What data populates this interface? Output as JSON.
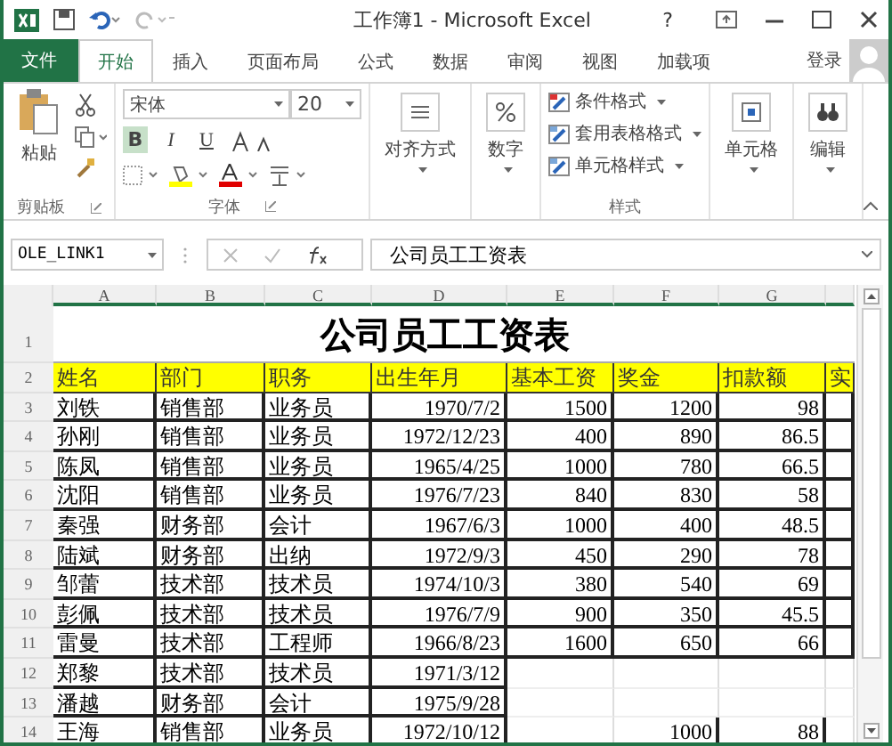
{
  "window": {
    "title": "工作簿1 - Microsoft Excel",
    "help": "?"
  },
  "tabs": [
    {
      "label": "文件",
      "kind": "file",
      "selected": false
    },
    {
      "label": "开始",
      "kind": "tab",
      "selected": true
    },
    {
      "label": "插入",
      "kind": "tab",
      "selected": false
    },
    {
      "label": "页面布局",
      "kind": "tab",
      "selected": false
    },
    {
      "label": "公式",
      "kind": "tab",
      "selected": false
    },
    {
      "label": "数据",
      "kind": "tab",
      "selected": false
    },
    {
      "label": "审阅",
      "kind": "tab",
      "selected": false
    },
    {
      "label": "视图",
      "kind": "tab",
      "selected": false
    },
    {
      "label": "加载项",
      "kind": "tab",
      "selected": false
    }
  ],
  "login": "登录",
  "ribbon": {
    "paste": "粘贴",
    "clipboard_group": "剪贴板",
    "font_name": "宋体",
    "font_size": "20",
    "styles": [
      {
        "label": "B",
        "kind": "bold",
        "selected": true
      },
      {
        "label": "I",
        "kind": "italic",
        "selected": false
      },
      {
        "label": "U",
        "kind": "underline",
        "selected": false
      }
    ],
    "font_group": "字体",
    "alignment": "对齐方式",
    "number": "数字",
    "style_items": [
      "条件格式",
      "套用表格格式",
      "单元格样式"
    ],
    "styles_group": "样式",
    "cells": "单元格",
    "editing": "编辑"
  },
  "formula_bar": {
    "name_box": "OLE_LINK1",
    "formula": "公司员工工资表"
  },
  "sheet": {
    "columns": [
      "A",
      "B",
      "C",
      "D",
      "E",
      "F",
      "G"
    ],
    "title_row": {
      "num": "1",
      "text": "公司员工工资表"
    },
    "header_row": {
      "num": "2",
      "cells": [
        "姓名",
        "部门",
        "职务",
        "出生年月",
        "基本工资",
        "奖金",
        "扣款额",
        "实"
      ]
    },
    "rows": [
      {
        "num": "3",
        "cells": [
          "刘铁",
          "销售部",
          "业务员",
          "1970/7/2",
          "1500",
          "1200",
          "98"
        ]
      },
      {
        "num": "4",
        "cells": [
          "孙刚",
          "销售部",
          "业务员",
          "1972/12/23",
          "400",
          "890",
          "86.5"
        ]
      },
      {
        "num": "5",
        "cells": [
          "陈凤",
          "销售部",
          "业务员",
          "1965/4/25",
          "1000",
          "780",
          "66.5"
        ]
      },
      {
        "num": "6",
        "cells": [
          "沈阳",
          "销售部",
          "业务员",
          "1976/7/23",
          "840",
          "830",
          "58"
        ]
      },
      {
        "num": "7",
        "cells": [
          "秦强",
          "财务部",
          "会计",
          "1967/6/3",
          "1000",
          "400",
          "48.5"
        ]
      },
      {
        "num": "8",
        "cells": [
          "陆斌",
          "财务部",
          "出纳",
          "1972/9/3",
          "450",
          "290",
          "78"
        ]
      },
      {
        "num": "9",
        "cells": [
          "邹蕾",
          "技术部",
          "技术员",
          "1974/10/3",
          "380",
          "540",
          "69"
        ]
      },
      {
        "num": "10",
        "cells": [
          "彭佩",
          "技术部",
          "技术员",
          "1976/7/9",
          "900",
          "350",
          "45.5"
        ]
      },
      {
        "num": "11",
        "cells": [
          "雷曼",
          "技术部",
          "工程师",
          "1966/8/23",
          "1600",
          "650",
          "66"
        ]
      },
      {
        "num": "12",
        "cells": [
          "郑黎",
          "技术部",
          "技术员",
          "1971/3/12",
          null,
          null,
          null
        ]
      },
      {
        "num": "13",
        "cells": [
          "潘越",
          "财务部",
          "会计",
          "1975/9/28",
          null,
          null,
          null
        ]
      },
      {
        "num": "14",
        "cells": [
          "王海",
          "销售部",
          "业务员",
          "1972/10/12",
          null,
          "1000",
          "88"
        ]
      }
    ]
  }
}
